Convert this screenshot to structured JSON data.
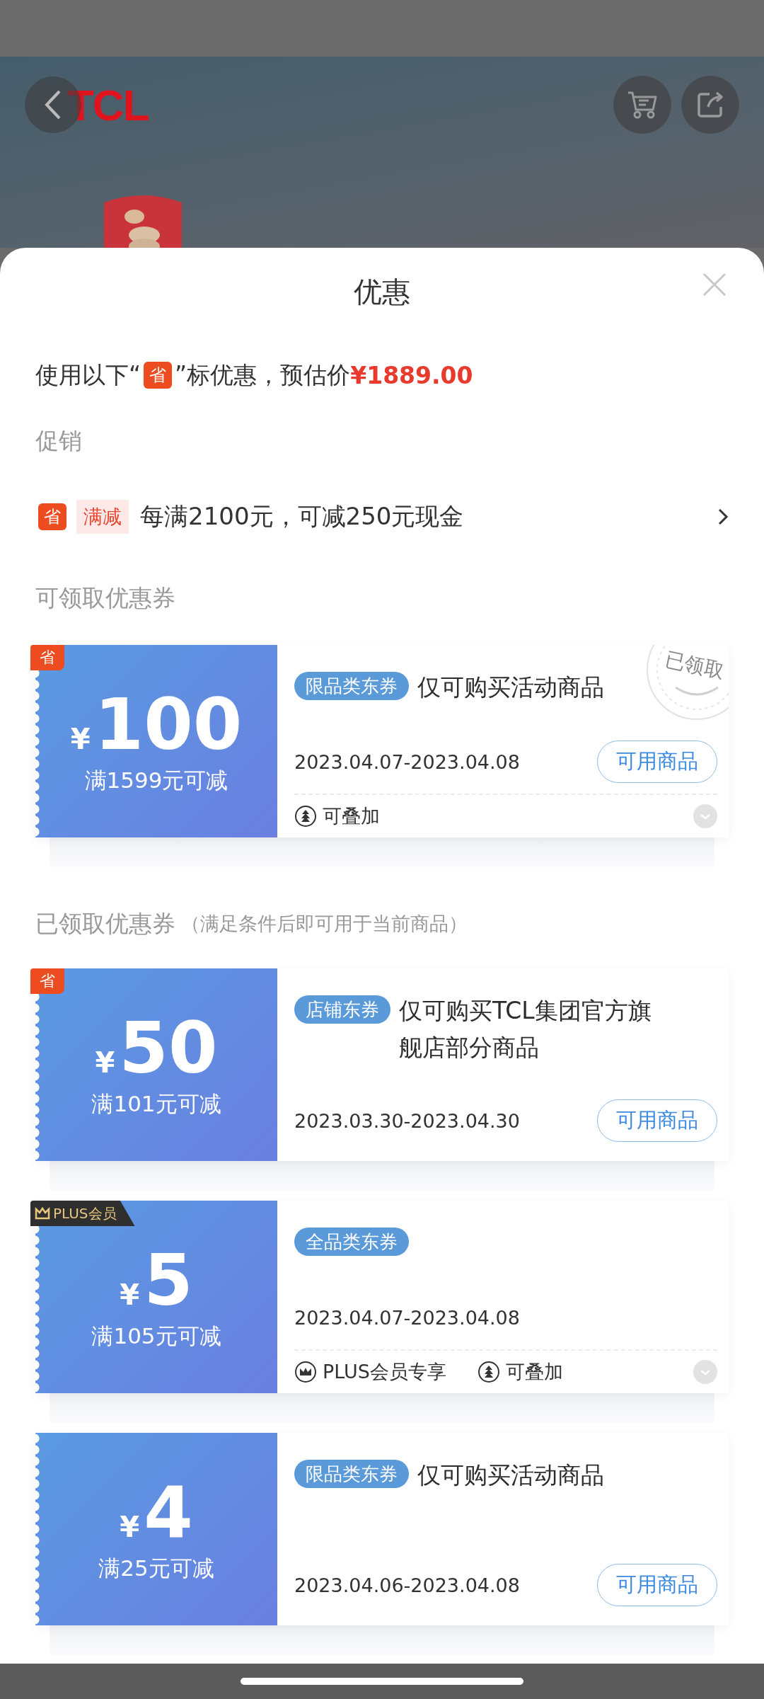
{
  "background_page": {
    "logo": "TCL"
  },
  "sheet": {
    "title": "优惠",
    "estimate": {
      "prefix": "使用以下“",
      "badge": "省",
      "suffix": "”标优惠，预估价",
      "price": "¥1889.00"
    },
    "promo_heading": "促销",
    "promotions": [
      {
        "badge": "省",
        "tag": "满减",
        "text": "每满2100元，可减250元现金"
      }
    ],
    "sections": [
      {
        "title": "可领取优惠券",
        "coupons": [
          {
            "corner": {
              "kind": "save",
              "text": "省"
            },
            "currency": "¥",
            "amount": "100",
            "condition": "满1599元可减",
            "tag": "限品类东券",
            "desc": "仅可购买活动商品",
            "dates": "2023.04.07-2023.04.08",
            "button": "可用商品",
            "stamp": "已领取",
            "features": [
              {
                "kind": "stack",
                "text": "可叠加"
              }
            ],
            "expandable": true
          }
        ]
      },
      {
        "title": "已领取优惠券",
        "note": "（满足条件后即可用于当前商品）",
        "coupons": [
          {
            "corner": {
              "kind": "save",
              "text": "省"
            },
            "currency": "¥",
            "amount": "50",
            "condition": "满101元可减",
            "tag": "店铺东券",
            "desc": "仅可购买TCL集团官方旗舰店部分商品",
            "dates": "2023.03.30-2023.04.30",
            "button": "可用商品"
          },
          {
            "corner": {
              "kind": "plus",
              "text": "PLUS会员"
            },
            "currency": "¥",
            "amount": "5",
            "condition": "满105元可减",
            "tag": "全品类东券",
            "dates": "2023.04.07-2023.04.08",
            "features": [
              {
                "kind": "crown",
                "text": "PLUS会员专享"
              },
              {
                "kind": "stack",
                "text": "可叠加"
              }
            ],
            "expandable": true
          },
          {
            "currency": "¥",
            "amount": "4",
            "condition": "满25元可减",
            "tag": "限品类东券",
            "desc": "仅可购买活动商品",
            "dates": "2023.04.06-2023.04.08",
            "button": "可用商品"
          }
        ]
      }
    ]
  }
}
